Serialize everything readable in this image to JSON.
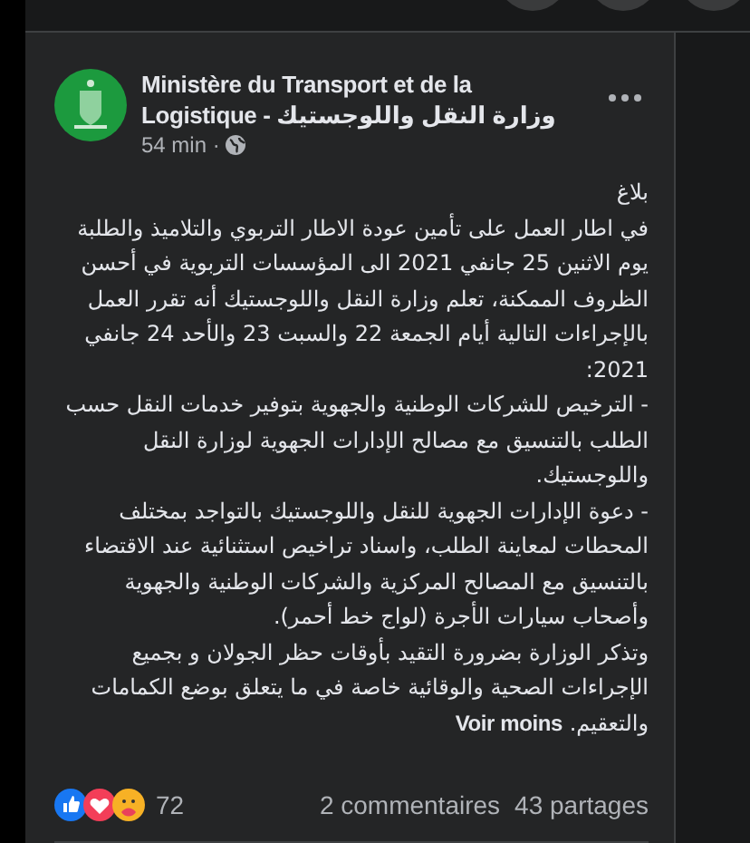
{
  "post": {
    "author": "Ministère du Transport et de la Logistique - وزارة النقل واللوجستيك",
    "time": "54 min ·",
    "paragraphs": [
      "بلاغ",
      "في اطار العمل على تأمين عودة الاطار التربوي والتلاميذ والطلبة يوم الاثنين 25 جانفي 2021 الى المؤسسات التربوية في أحسن الظروف الممكنة، تعلم وزارة النقل واللوجستيك أنه تقرر العمل بالإجراءات التالية أيام الجمعة 22 والسبت 23 والأحد 24 جانفي 2021:",
      "- الترخيص للشركات الوطنية والجهوية بتوفير خدمات النقل حسب الطلب بالتنسيق مع مصالح الإدارات الجهوية لوزارة النقل واللوجستيك.",
      "- دعوة الإدارات الجهوية للنقل واللوجستيك بالتواجد بمختلف المحطات لمعاينة الطلب، واسناد تراخيص استثنائية عند الاقتضاء بالتنسيق مع المصالح المركزية والشركات الوطنية والجهوية وأصحاب سيارات الأجرة (لواج خط أحمر).",
      "وتذكر الوزارة بضرورة التقيد بأوقات حظر الجولان و بجميع الإجراءات الصحية والوقائية خاصة في ما يتعلق بوضع الكمامات والتعقيم."
    ],
    "see_less": "Voir moins",
    "reactions": {
      "count": "72"
    },
    "comments": "2 commentaires",
    "shares": "43 partages"
  }
}
